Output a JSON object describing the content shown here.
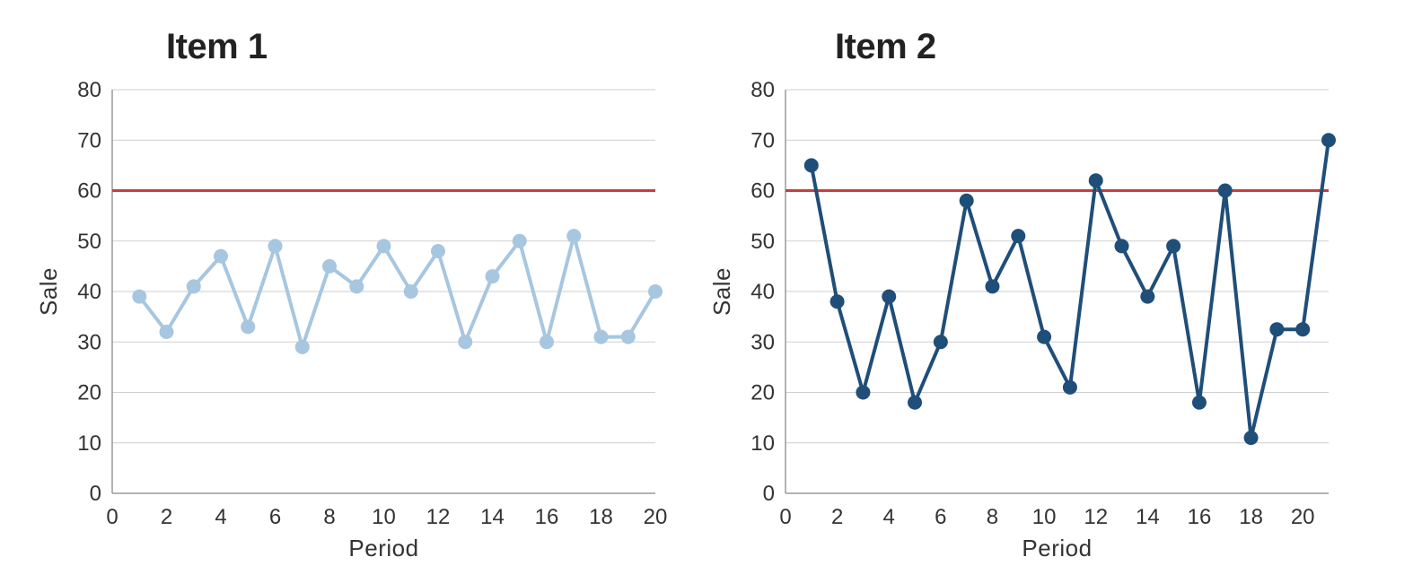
{
  "chart_data": [
    {
      "type": "line",
      "title": "Item 1",
      "xlabel": "Period",
      "ylabel": "Sale",
      "xlim": [
        0,
        20
      ],
      "ylim": [
        0,
        80
      ],
      "yticks": [
        0,
        10,
        20,
        30,
        40,
        50,
        60,
        70,
        80
      ],
      "xticks": [
        0,
        2,
        4,
        6,
        8,
        10,
        12,
        14,
        16,
        18,
        20
      ],
      "reference_line_y": 60,
      "x": [
        1,
        2,
        3,
        4,
        5,
        6,
        7,
        8,
        9,
        10,
        11,
        12,
        13,
        14,
        15,
        16,
        17,
        18,
        19,
        20
      ],
      "values": [
        39,
        32,
        41,
        47,
        33,
        49,
        29,
        45,
        41,
        49,
        40,
        48,
        30,
        43,
        50,
        30,
        51,
        31,
        31,
        40
      ],
      "line_color": "#a7c6e0",
      "reference_color": "#cc3c3c"
    },
    {
      "type": "line",
      "title": "Item 2",
      "xlabel": "Period",
      "ylabel": "Sale",
      "xlim": [
        0,
        21
      ],
      "ylim": [
        0,
        80
      ],
      "yticks": [
        0,
        10,
        20,
        30,
        40,
        50,
        60,
        70,
        80
      ],
      "xticks": [
        0,
        2,
        4,
        6,
        8,
        10,
        12,
        14,
        16,
        18,
        20
      ],
      "reference_line_y": 60,
      "x": [
        1,
        2,
        3,
        4,
        5,
        6,
        7,
        8,
        9,
        10,
        11,
        12,
        13,
        14,
        15,
        16,
        17,
        18,
        19,
        20,
        21
      ],
      "values": [
        65,
        38,
        20,
        39,
        18,
        30,
        58,
        41,
        51,
        31,
        21,
        62,
        49,
        39,
        49,
        18,
        60,
        11,
        32.5,
        32.5,
        70
      ],
      "line_color": "#1f4e79",
      "reference_color": "#cc3c3c"
    }
  ]
}
